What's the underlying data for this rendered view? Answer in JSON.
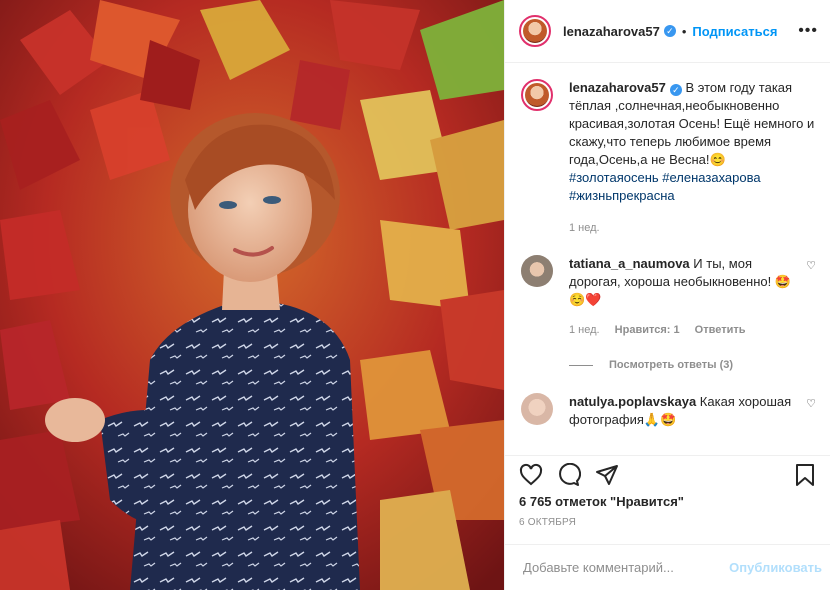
{
  "post": {
    "username": "lenazaharova57",
    "separator": "•",
    "follow_label": "Подписаться",
    "more_icon": "ellipsis-icon",
    "caption_text": "В этом году такая тёплая ,солнечная,необыкновенно красивая,золотая Осень! Ещё немного и скажу,что теперь любимое время года,Осень,а не Весна!😊 ",
    "caption_tags": "#золотаяосень #еленазахарова #жизньпрекрасна",
    "caption_time": "1 нед."
  },
  "comments": [
    {
      "username": "tatiana_a_naumova",
      "text": "И ты, моя дорогая, хороша необыкновенно! 🤩☺️❤️",
      "time": "1 нед.",
      "likes": "Нравится: 1",
      "reply": "Ответить",
      "view_replies": "Посмотреть ответы (3)"
    },
    {
      "username": "natulya.poplavskaya",
      "text": "Какая хорошая фотография🙏🤩"
    }
  ],
  "actions": {
    "likes_count": "6 765 отметок \"Нравится\"",
    "date": "6 ОКТЯБРЯ"
  },
  "add_comment": {
    "placeholder": "Добавьте комментарий...",
    "publish_label": "Опубликовать"
  },
  "colors": {
    "accent": "#0095f6",
    "verified": "#3897f0",
    "hashtag": "#00376b",
    "muted": "#8e8e8e"
  }
}
